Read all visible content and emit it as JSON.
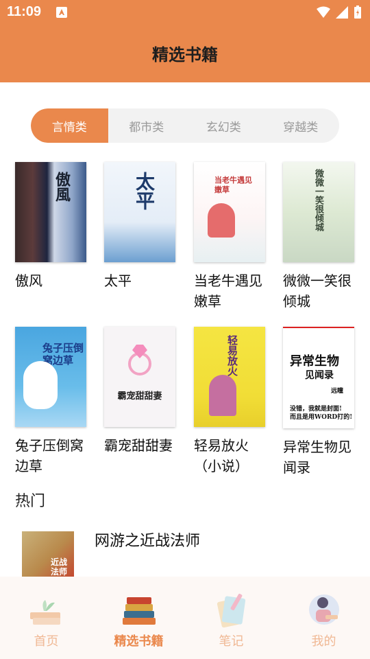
{
  "status": {
    "time": "11:09"
  },
  "header": {
    "title": "精选书籍"
  },
  "tabs": [
    {
      "label": "言情类",
      "active": true
    },
    {
      "label": "都市类",
      "active": false
    },
    {
      "label": "玄幻类",
      "active": false
    },
    {
      "label": "穿越类",
      "active": false
    }
  ],
  "books": [
    {
      "title": "傲风",
      "cover_text": "傲風"
    },
    {
      "title": "太平",
      "cover_text": "太平"
    },
    {
      "title": "当老牛遇见嫩草",
      "cover_text": "当老牛遇见嫩草"
    },
    {
      "title": "微微一笑很倾城",
      "cover_text": "微微一笑很倾城"
    },
    {
      "title": "兔子压倒窝边草",
      "cover_text": "兔子压倒窝边草"
    },
    {
      "title": "霸宠甜甜妻",
      "cover_text": "霸宠甜甜妻"
    },
    {
      "title": "轻易放火（小说）",
      "cover_text": "轻易放火"
    },
    {
      "title": "异常生物见闻录",
      "cover_text": "异常生物",
      "cover_text2": "见闻录",
      "cover_author": "远瞳",
      "cover_line1": "没错，我就是封面!",
      "cover_line2": "而且是用WORD打的!"
    }
  ],
  "hot": {
    "section_title": "热门",
    "book_title": "网游之近战法师",
    "cover_text": "近战法师"
  },
  "nav": [
    {
      "label": "首页",
      "icon": "home-icon",
      "active": false
    },
    {
      "label": "精选书籍",
      "icon": "books-icon",
      "active": true
    },
    {
      "label": "笔记",
      "icon": "notes-icon",
      "active": false
    },
    {
      "label": "我的",
      "icon": "profile-icon",
      "active": false
    }
  ]
}
